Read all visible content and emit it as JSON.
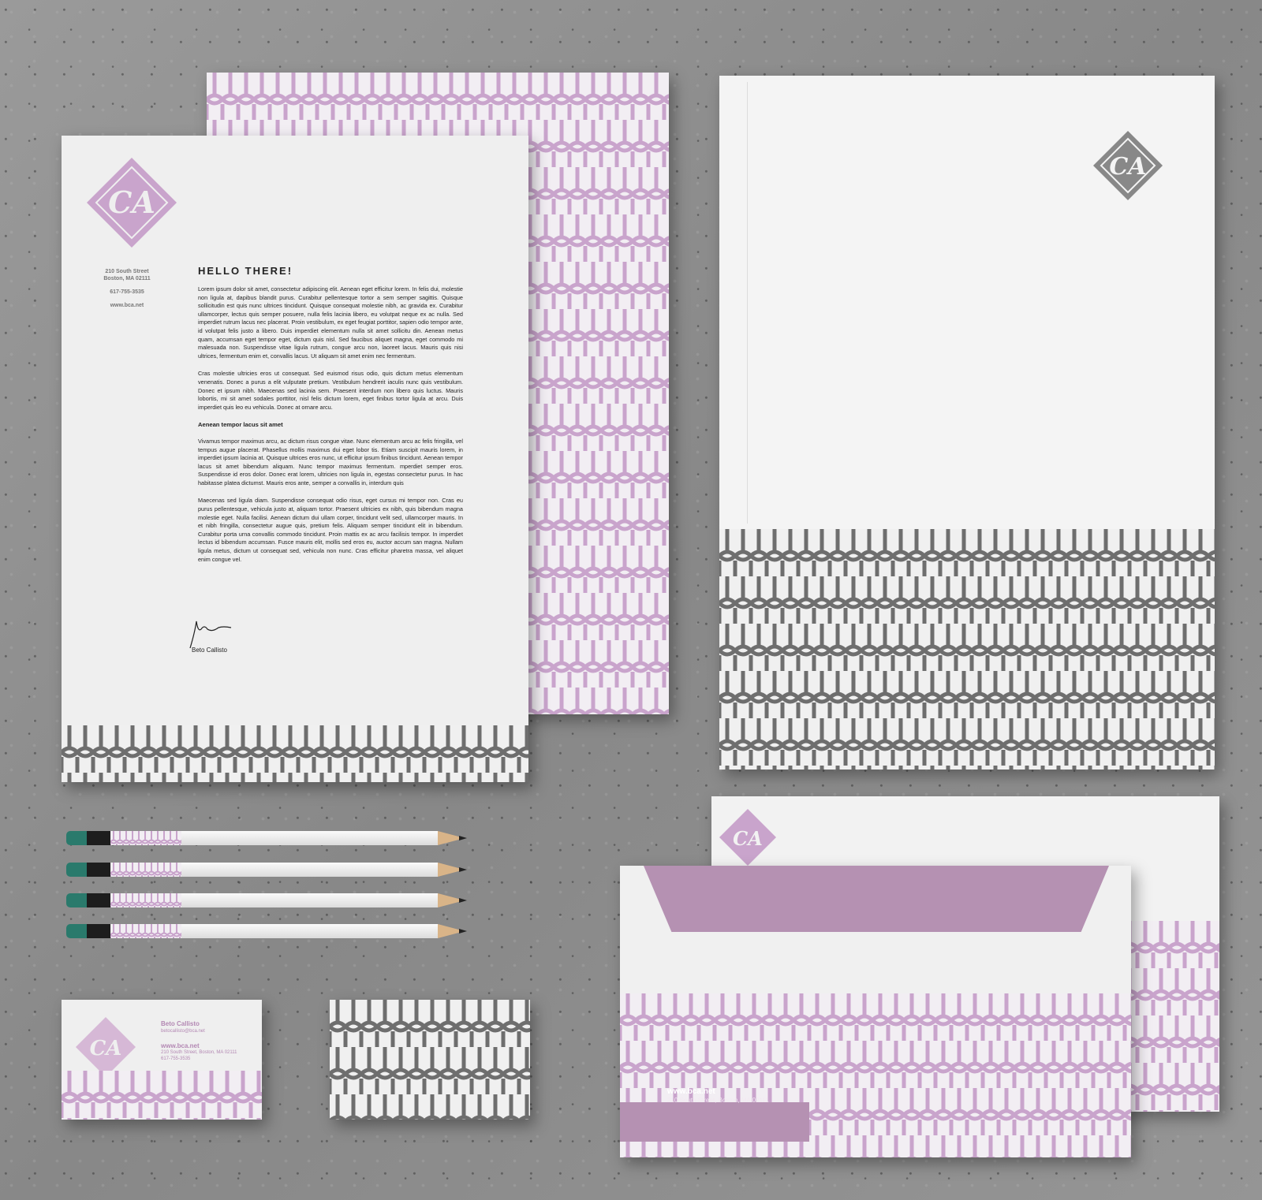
{
  "letterhead": {
    "address_line1": "210 South Street",
    "address_line2": "Boston, MA 02111",
    "phone": "617-755-3535",
    "website": "www.bca.net",
    "title": "HELLO THERE!",
    "paragraph1": "Lorem ipsum dolor sit amet, consectetur adipiscing elit. Aenean eget efficitur lorem. In felis dui, molestie non ligula at, dapibus blandit purus. Curabitur pellentesque tortor a sem semper sagittis. Quisque sollicitudin est quis nunc ultrices tincidunt. Quisque consequat molestie nibh, ac gravida ex. Curabitur ullamcorper, lectus quis semper posuere, nulla felis lacinia libero, eu volutpat neque ex ac nulla. Sed imperdiet rutrum lacus nec placerat. Proin vestibulum, ex eget feugiat porttitor, sapien odio tempor ante, id volutpat felis justo a libero. Duis imperdiet elementum nulla sit amet sollicitu din. Aenean metus quam, accumsan eget tempor eget, dictum quis nisl. Sed faucibus aliquet magna, eget commodo mi malesuada non. Suspendisse vitae ligula rutrum, congue arcu non, laoreet lacus. Mauris quis nisi ultrices, fermentum enim et, convallis lacus. Ut aliquam sit amet enim nec fermentum.",
    "paragraph2": "Cras molestie ultricies eros ut consequat. Sed euismod risus odio, quis dictum metus elementum venenatis. Donec a purus a elit vulputate pretium. Vestibulum hendrerit iaculis nunc quis vestibulum. Donec et ipsum nibh. Maecenas sed lacinia sem. Praesent interdum non libero quis luctus. Mauris lobortis, mi sit amet sodales porttitor, nisl felis dictum lorem, eget finibus tortor ligula at arcu. Duis imperdiet quis leo eu vehicula. Donec at ornare arcu.",
    "subheading": "Aenean tempor lacus sit amet",
    "paragraph3": "Vivamus tempor maximus arcu, ac dictum risus congue vitae. Nunc elementum arcu ac felis fringilla, vel tempus augue placerat. Phasellus mollis maximus dui eget lobor tis. Etiam suscipit mauris lorem, in imperdiet ipsum lacinia at. Quisque ultrices eros nunc, ut efficitur ipsum finibus tincidunt. Aenean tempor lacus sit amet bibendum aliquam. Nunc tempor maximus fermentum. mperdiet semper eros. Suspendisse id eros dolor. Donec erat lorem, ultricies non ligula in, egestas consectetur purus. In hac habitasse platea dictumst. Mauris eros ante, semper a convallis in, interdum quis",
    "paragraph4": "Maecenas sed ligula diam. Suspendisse consequat odio risus, eget cursus mi tempor non. Cras eu purus pellentesque, vehicula justo at, aliquam tortor. Praesent ultricies ex nibh, quis bibendum magna molestie eget. Nulla facilisi. Aenean dictum dui ullam corper, tincidunt velit sed, ullamcorper mauris. In et nibh fringilla, consectetur augue quis, pretium felis. Aliquam semper tincidunt elit in bibendum. Curabitur porta urna convallis commodo tincidunt. Proin mattis ex ac arcu facilisis tempor. In imperdiet lectus id bibendum accumsan. Fusce mauris elit, mollis sed eros eu, auctor accum san magna. Nullam ligula metus, dictum ut consequat sed, vehicula non nunc. Cras efficitur pharetra massa, vel aliquet enim congue vel.",
    "signature_name": "Beto Callisto"
  },
  "monogram": "CA",
  "business_card": {
    "name": "Beto Callisto",
    "email": "betocallisto@bca.net",
    "website": "www.bca.net",
    "address": "210 South Street, Boston, MA 02111",
    "phone": "617-755-3535"
  },
  "envelope": {
    "website": "www.bca.net",
    "address": "210 South Street, Boston, MA 02111"
  },
  "colors": {
    "lilac": "#b591b2",
    "gray": "#6e6e6e",
    "paper": "#efefef"
  }
}
